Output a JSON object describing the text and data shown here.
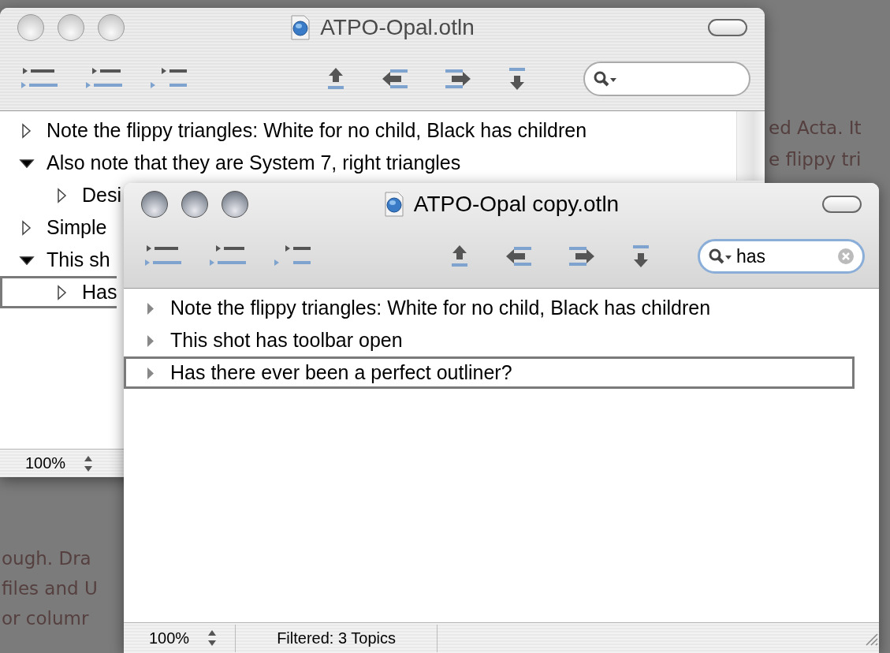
{
  "backdrop": {
    "right_lines": [
      "ed Acta. It",
      "e flippy tri"
    ],
    "left_lines": [
      "ough. Dra",
      "files and U",
      "or columr"
    ]
  },
  "windows": [
    {
      "title": "ATPO-Opal.otln",
      "active": false,
      "kind": "system7",
      "rows": [
        {
          "text": "Note the flippy triangles: White for no child, Black has children",
          "has_children": false,
          "expanded": false,
          "selected": false
        },
        {
          "text": "Also note that they are System 7, right triangles",
          "has_children": true,
          "expanded": true,
          "selected": false,
          "children": [
            {
              "text": "Desi",
              "has_children": false,
              "expanded": false,
              "selected": false
            }
          ]
        },
        {
          "text": "Simple",
          "has_children": false,
          "expanded": false,
          "selected": false
        },
        {
          "text": "This sh",
          "has_children": true,
          "expanded": true,
          "selected": false,
          "children": [
            {
              "text": "Has",
              "has_children": false,
              "expanded": false,
              "selected": true
            }
          ]
        }
      ],
      "status": {
        "zoom": "100%"
      }
    },
    {
      "title": "ATPO-Opal copy.otln",
      "active": true,
      "kind": "aqua",
      "search": {
        "value": "has"
      },
      "rows": [
        {
          "text": "Note the flippy triangles: White for no child, Black has children",
          "has_children": false,
          "expanded": false,
          "selected": false
        },
        {
          "text": "This shot has toolbar open",
          "has_children": false,
          "expanded": false,
          "selected": false
        },
        {
          "text": "Has there ever been a perfect outliner?",
          "has_children": false,
          "expanded": false,
          "selected": true
        }
      ],
      "status": {
        "zoom": "100%",
        "filter": "Filtered: 3 Topics"
      }
    }
  ]
}
